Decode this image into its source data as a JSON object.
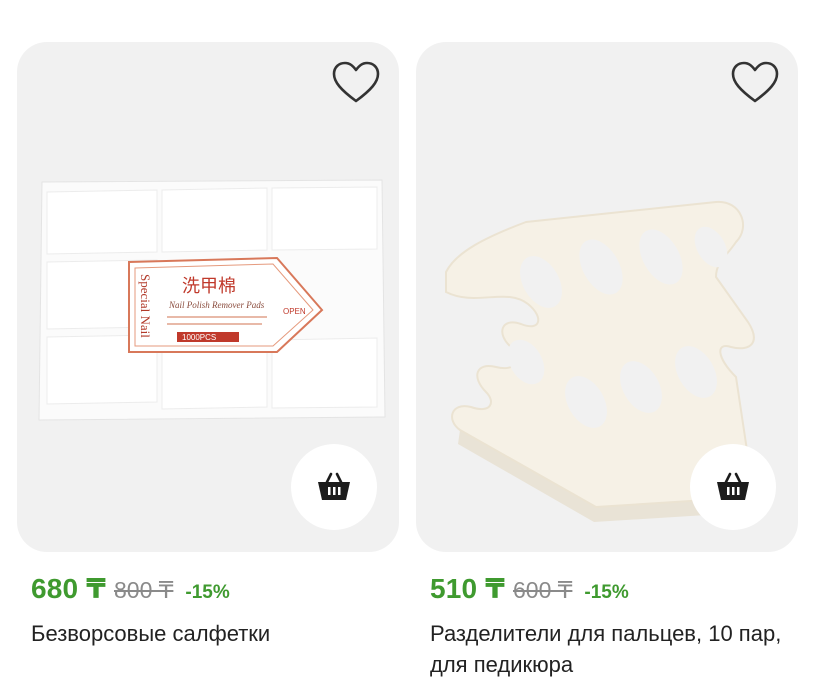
{
  "products": [
    {
      "price": "680 ₸",
      "old_price": "800 ₸",
      "discount": "-15%",
      "title": "Безворсовые салфетки",
      "package_text": {
        "chinese": "洗甲棉",
        "brand": "Special Nail",
        "product": "Nail Polish Remover Pads",
        "count": "1000PCS",
        "tab": "OPEN"
      }
    },
    {
      "price": "510 ₸",
      "old_price": "600 ₸",
      "discount": "-15%",
      "title": "Разделители для пальцев, 10 пар, для педикюра"
    }
  ],
  "icons": {
    "favorite": "heart-icon",
    "cart": "basket-icon"
  },
  "colors": {
    "price": "#3f9a2f",
    "card_bg": "#f1f1f1",
    "old_price": "#8a8a8a"
  }
}
